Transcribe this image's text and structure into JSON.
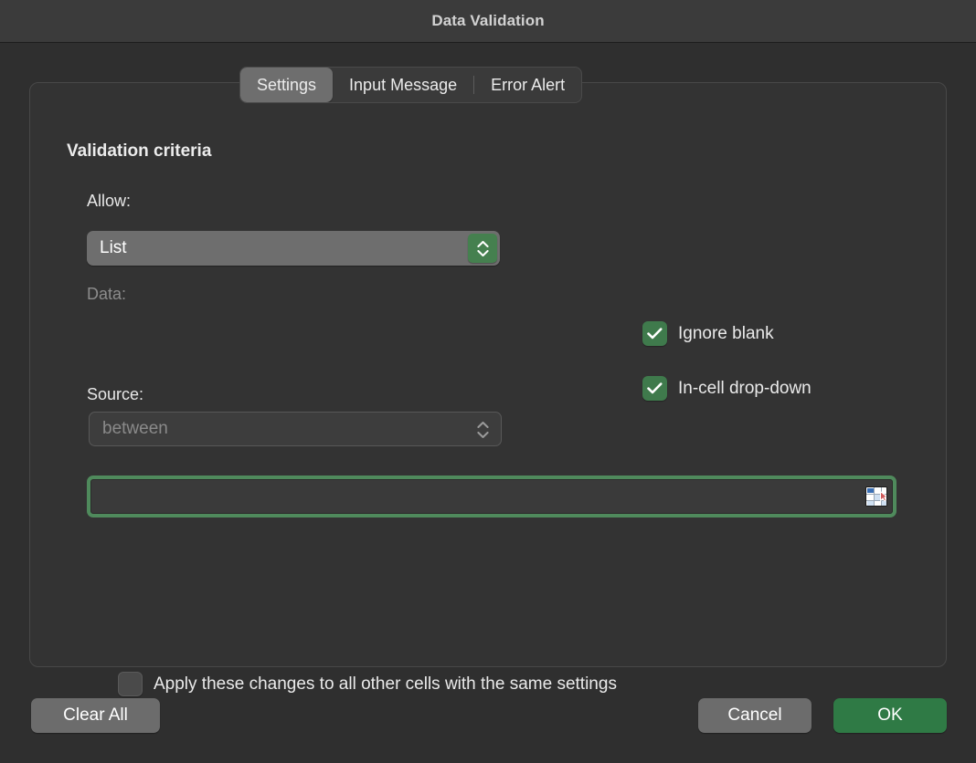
{
  "window": {
    "title": "Data Validation"
  },
  "tabs": [
    {
      "label": "Settings",
      "active": true
    },
    {
      "label": "Input Message",
      "active": false
    },
    {
      "label": "Error Alert",
      "active": false
    }
  ],
  "settings": {
    "section_title": "Validation criteria",
    "allow": {
      "label": "Allow:",
      "value": "List",
      "enabled": true,
      "stepper_icon": "chevron-up-down-icon"
    },
    "data": {
      "label": "Data:",
      "value": "between",
      "enabled": false,
      "stepper_icon": "chevron-up-down-icon"
    },
    "source": {
      "label": "Source:",
      "value": "",
      "placeholder": "",
      "focused": true,
      "picker_icon": "range-selector-icon"
    },
    "options": [
      {
        "label": "Ignore blank",
        "checked": true
      },
      {
        "label": "In-cell drop-down",
        "checked": true
      }
    ],
    "apply_all": {
      "label": "Apply these changes to all other cells with the same settings",
      "checked": false
    }
  },
  "footer": {
    "clear_all_label": "Clear All",
    "cancel_label": "Cancel",
    "ok_label": "OK"
  },
  "colors": {
    "accent_green": "#3f7a4c",
    "ok_button_green": "#2f7a45",
    "focus_ring_green": "#4f8a5c",
    "window_bg": "#2f2f2f",
    "titlebar_bg": "#3b3b3b",
    "panel_bg": "#333333"
  }
}
